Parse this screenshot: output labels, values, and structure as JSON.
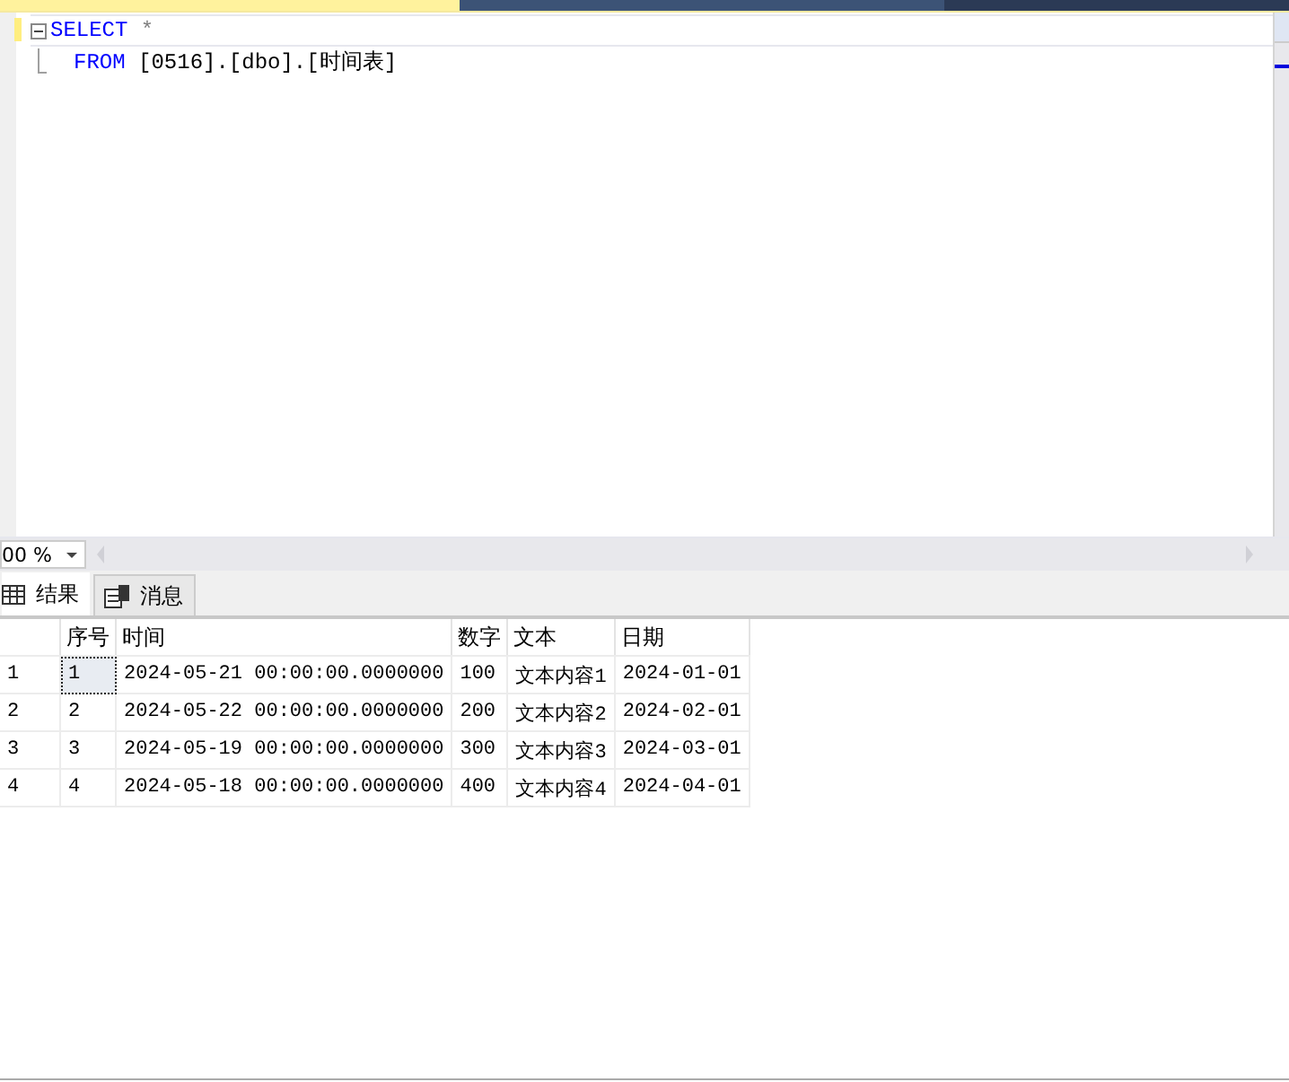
{
  "editor": {
    "lines": [
      {
        "keyword": "SELECT",
        "text": "*",
        "collapsible": true
      },
      {
        "keyword": "FROM",
        "text": "[0516].[dbo].[时间表]",
        "collapsible": false
      }
    ]
  },
  "zoom": {
    "value": "00 %"
  },
  "result_tabs": [
    {
      "label": "结果",
      "kind": "grid",
      "selected": true
    },
    {
      "label": "消息",
      "kind": "messages",
      "selected": false
    }
  ],
  "grid": {
    "columns": [
      "序号",
      "时间",
      "数字",
      "文本",
      "日期"
    ],
    "rows": [
      {
        "row_number": "1",
        "focused": true,
        "cells": [
          "1",
          "2024-05-21 00:00:00.0000000",
          "100",
          "文本内容1",
          "2024-01-01"
        ]
      },
      {
        "row_number": "2",
        "focused": false,
        "cells": [
          "2",
          "2024-05-22 00:00:00.0000000",
          "200",
          "文本内容2",
          "2024-02-01"
        ]
      },
      {
        "row_number": "3",
        "focused": false,
        "cells": [
          "3",
          "2024-05-19 00:00:00.0000000",
          "300",
          "文本内容3",
          "2024-03-01"
        ]
      },
      {
        "row_number": "4",
        "focused": false,
        "cells": [
          "4",
          "2024-05-18 00:00:00.0000000",
          "400",
          "文本内容4",
          "2024-04-01"
        ]
      }
    ]
  }
}
